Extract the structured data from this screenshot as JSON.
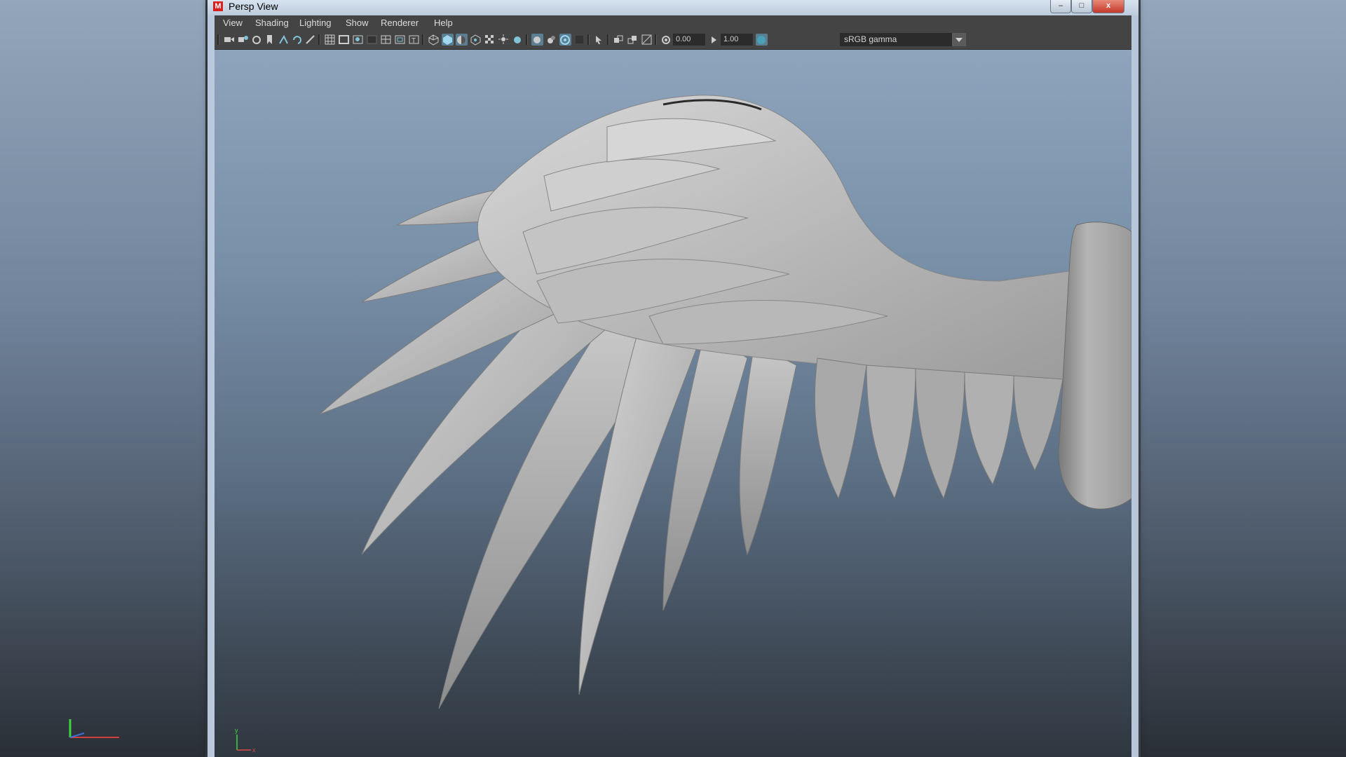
{
  "window": {
    "title": "Persp View",
    "app_icon_letter": "M",
    "buttons": {
      "minimize": "–",
      "maximize": "□",
      "close": "x"
    }
  },
  "menu": [
    "View",
    "Shading",
    "Lighting",
    "Show",
    "Renderer",
    "Help"
  ],
  "toolbar": {
    "exposure_value": "0.00",
    "gamma_value": "1.00",
    "color_space": "sRGB gamma",
    "icons": [
      "camera-icon",
      "camera-attr-icon",
      "bookmark-icon",
      "image-plane-icon",
      "grid-icon",
      "film-gate-icon",
      "resolution-gate-icon",
      "gate-mask-icon",
      "field-chart-icon",
      "safe-action-icon",
      "safe-title-icon",
      "wireframe-icon",
      "smooth-shade-icon",
      "wireframe-on-shaded-icon",
      "textured-icon",
      "default-light-icon",
      "all-lights-icon",
      "shadows-icon",
      "isolate-icon",
      "xray-icon",
      "xray-joints-icon",
      "backface-icon",
      "select-icon",
      "ao-icon",
      "motion-blur-icon",
      "aa-icon",
      "exposure-icon",
      "gamma-icon",
      "color-mgmt-icon"
    ]
  },
  "viewport": {
    "axis": {
      "y": "y",
      "x": "x"
    }
  },
  "colors": {
    "menu_bg": "#444444",
    "active_toggle": "#5a7f93",
    "model_grey": "#b4b4b4"
  }
}
